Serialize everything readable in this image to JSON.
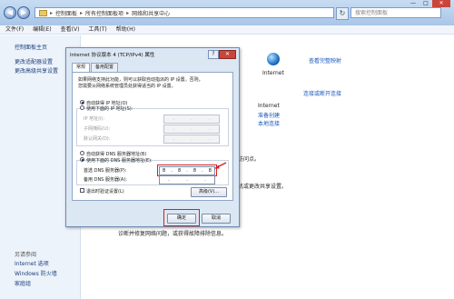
{
  "explorer": {
    "address_parts": [
      "控制面板",
      "所有控制面板项",
      "网络和共享中心"
    ],
    "search_placeholder": "搜索控制面板",
    "menu": [
      "文件(F)",
      "编辑(E)",
      "查看(V)",
      "工具(T)",
      "帮助(H)"
    ],
    "window_controls": [
      "—",
      "□",
      "✕"
    ]
  },
  "sidebar": {
    "home": "控制面板主页",
    "links": [
      "更改适配器设置",
      "更改高级共享设置"
    ],
    "see_also_heading": "另请参阅",
    "see_also": [
      "Internet 选项",
      "Windows 防火墙",
      "家庭组"
    ]
  },
  "main": {
    "view_full_map": "查看完整映射",
    "internet_label": "Internet",
    "connect_disconnect": "连接或断开连接",
    "access_type_label": "Internet",
    "homegroup_label": "准备创建",
    "local_connection": "本地连接",
    "partial_1": "访问点。",
    "partial_2": "机或更改共享设置。",
    "partial_3": "诊断并修复网络问题，或获得故障排除信息。"
  },
  "dialog": {
    "title": "Internet 协议版本 4 (TCP/IPv4) 属性",
    "help_btn": "?",
    "close_btn": "✕",
    "tabs": [
      "常规",
      "备用配置"
    ],
    "desc_line1": "如果网络支持此功能，则可以获取自动指派的 IP 设置。否则，",
    "desc_line2": "您需要从网络系统管理员处获得适当的 IP 设置。",
    "auto_ip": "自动获得 IP 地址(O)",
    "manual_ip": "使用下面的 IP 地址(S):",
    "ip_label": "IP 地址(I):",
    "mask_label": "子网掩码(U):",
    "gateway_label": "默认网关(D):",
    "auto_dns": "自动获得 DNS 服务器地址(B)",
    "manual_dns": "使用下面的 DNS 服务器地址(E):",
    "pref_dns_label": "首选 DNS 服务器(P):",
    "pref_dns_value": [
      "8",
      "8",
      "8",
      "8"
    ],
    "alt_dns_label": "备用 DNS 服务器(A):",
    "validate_label": "退出时验证设置(L)",
    "advanced_btn": "高级(V)...",
    "ok_btn": "确定",
    "cancel_btn": "取消"
  }
}
